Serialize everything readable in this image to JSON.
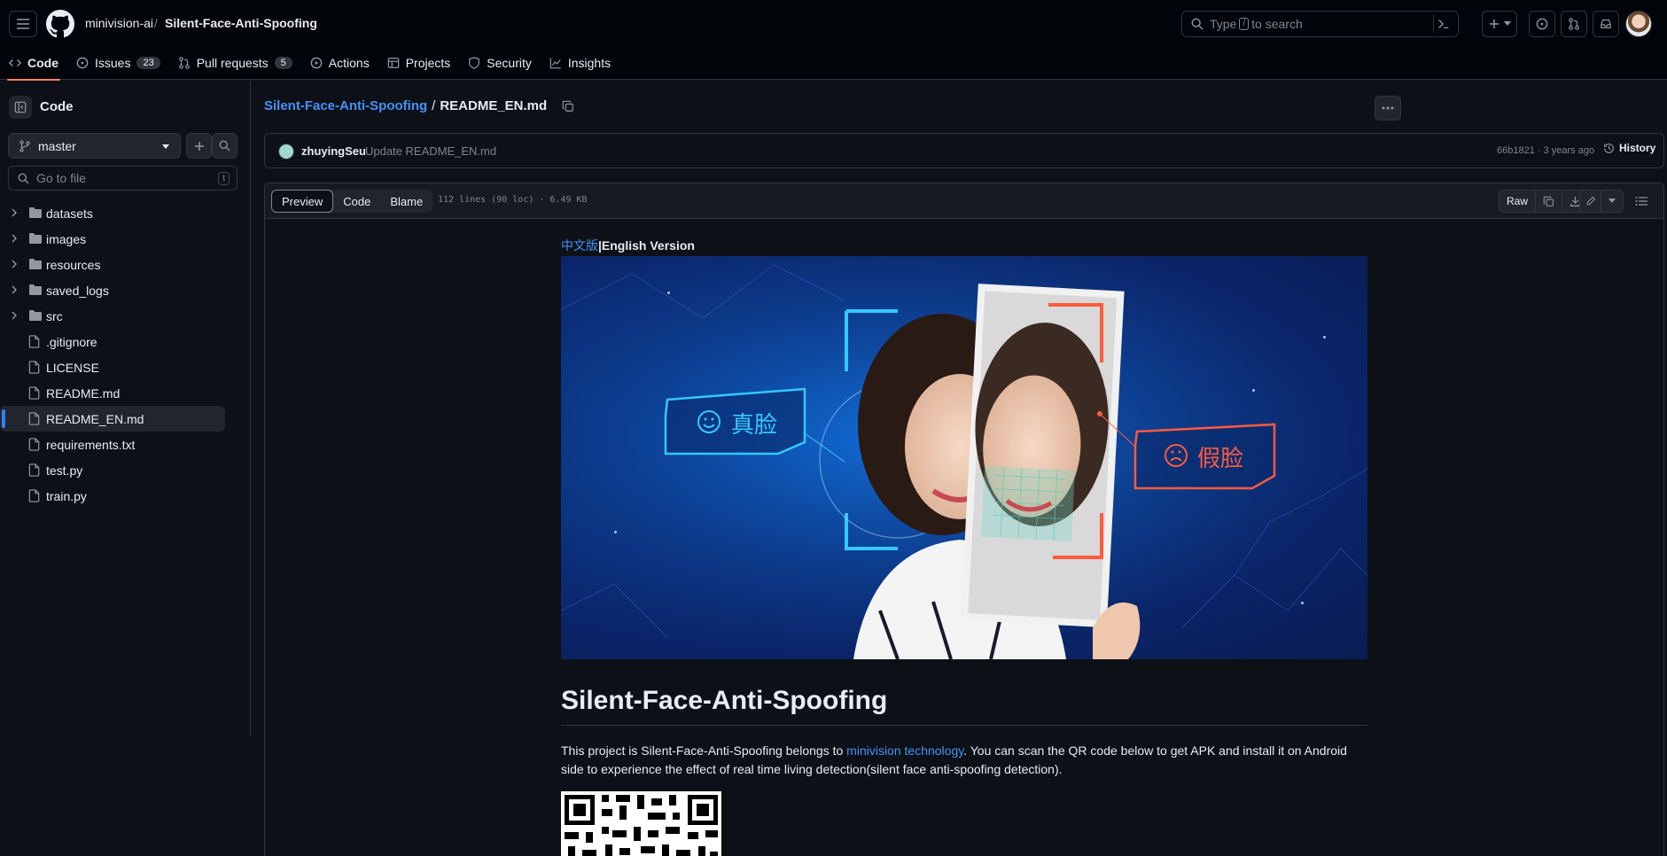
{
  "header": {
    "owner": "minivision-ai",
    "separator": "/",
    "repo": "Silent-Face-Anti-Spoofing",
    "search_prefix": "Type",
    "search_key": "/",
    "search_suffix": "to search"
  },
  "repo_nav": [
    {
      "label": "Code",
      "icon": "code-icon",
      "selected": true
    },
    {
      "label": "Issues",
      "icon": "issue-icon",
      "count": "23"
    },
    {
      "label": "Pull requests",
      "icon": "pull-request-icon",
      "count": "5"
    },
    {
      "label": "Actions",
      "icon": "play-icon"
    },
    {
      "label": "Projects",
      "icon": "table-icon"
    },
    {
      "label": "Security",
      "icon": "shield-icon"
    },
    {
      "label": "Insights",
      "icon": "graph-icon"
    }
  ],
  "sidebar": {
    "title": "Code",
    "branch": "master",
    "goto_placeholder": "Go to file",
    "goto_key": "t",
    "items": [
      {
        "name": "datasets",
        "type": "folder"
      },
      {
        "name": "images",
        "type": "folder"
      },
      {
        "name": "resources",
        "type": "folder"
      },
      {
        "name": "saved_logs",
        "type": "folder"
      },
      {
        "name": "src",
        "type": "folder"
      },
      {
        "name": ".gitignore",
        "type": "file"
      },
      {
        "name": "LICENSE",
        "type": "file"
      },
      {
        "name": "README.md",
        "type": "file"
      },
      {
        "name": "README_EN.md",
        "type": "file",
        "active": true
      },
      {
        "name": "requirements.txt",
        "type": "file"
      },
      {
        "name": "test.py",
        "type": "file"
      },
      {
        "name": "train.py",
        "type": "file"
      }
    ]
  },
  "path": {
    "repo_link": "Silent-Face-Anti-Spoofing",
    "sep": "/",
    "file": "README_EN.md"
  },
  "commit": {
    "author": "zhuyingSeu",
    "message": "Update README_EN.md",
    "meta": "66b1821 · 3 years ago",
    "history_label": "History"
  },
  "file_header": {
    "tabs": [
      "Preview",
      "Code",
      "Blame"
    ],
    "active_tab": "Preview",
    "lines_info": "112 lines (90 loc) · 6.49 KB",
    "raw_label": "Raw"
  },
  "readme": {
    "lang_zh": "中文版",
    "lang_sep": "|",
    "lang_en": "English Version",
    "hero": {
      "real_label": "真脸",
      "fake_label": "假脸"
    },
    "title": "Silent-Face-Anti-Spoofing",
    "para_before": "This project is Silent-Face-Anti-Spoofing belongs to ",
    "para_link": "minivision technology",
    "para_after": ". You can scan the QR code below to get APK and install it on Android side to experience the effect of real time living detection(silent face anti-spoofing detection)."
  },
  "colors": {
    "accent_blue": "#4493f8",
    "nav_underline": "#f78166",
    "real_cyan": "#35c8ff",
    "fake_red": "#ff5a3c"
  }
}
